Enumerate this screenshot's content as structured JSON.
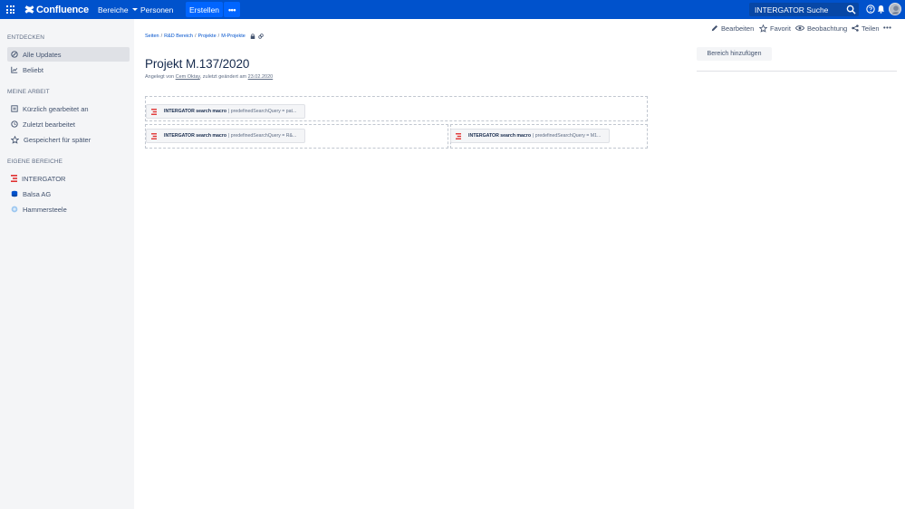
{
  "topbar": {
    "logo_text": "Confluence",
    "nav_spaces": "Bereiche",
    "nav_people": "Personen",
    "create_label": "Erstellen",
    "more_label": "•••",
    "search_label": "INTERGATOR Suche",
    "brand_color": "#0052cc"
  },
  "sidebar": {
    "section_discover": "ENTDECKEN",
    "discover_items": [
      {
        "label": "Alle Updates",
        "icon": "updates-icon"
      },
      {
        "label": "Beliebt",
        "icon": "chart-icon"
      }
    ],
    "section_mywork": "MEINE ARBEIT",
    "mywork_items": [
      {
        "label": "Kürzlich gearbeitet an",
        "icon": "recent-icon"
      },
      {
        "label": "Zuletzt bearbeitet",
        "icon": "clock-icon"
      },
      {
        "label": "Gespeichert für später",
        "icon": "star-icon"
      }
    ],
    "section_spaces": "EIGENE BEREICHE",
    "space_items": [
      {
        "label": "INTERGATOR",
        "icon": "intergator-icon"
      },
      {
        "label": "Balsa AG",
        "icon": "database-icon"
      },
      {
        "label": "Hammersteele",
        "icon": "globe-icon"
      }
    ]
  },
  "breadcrumb": [
    "Seiten",
    "R&D Bereich",
    "Projekte",
    "M-Projekte"
  ],
  "page": {
    "title": "Projekt M.137/2020",
    "byline_prefix": "Angelegt von",
    "author": "Cem Oktay",
    "byline_middle": ", zuletzt geändert am",
    "modified_date": "23.02.2020"
  },
  "actions": {
    "edit": "Bearbeiten",
    "favorite": "Favorit",
    "watch": "Beobachtung",
    "share": "Teilen",
    "more": "•••"
  },
  "right_panel": {
    "add_space": "Bereich hinzufügen"
  },
  "macros": [
    {
      "name": "INTERGATOR search macro",
      "params": "| predefinedSearchQuery = pat..."
    },
    {
      "name": "INTERGATOR search macro",
      "params": "| predefinedSearchQuery = R&..."
    },
    {
      "name": "INTERGATOR search macro",
      "params": "| predefinedSearchQuery = M1..."
    }
  ]
}
